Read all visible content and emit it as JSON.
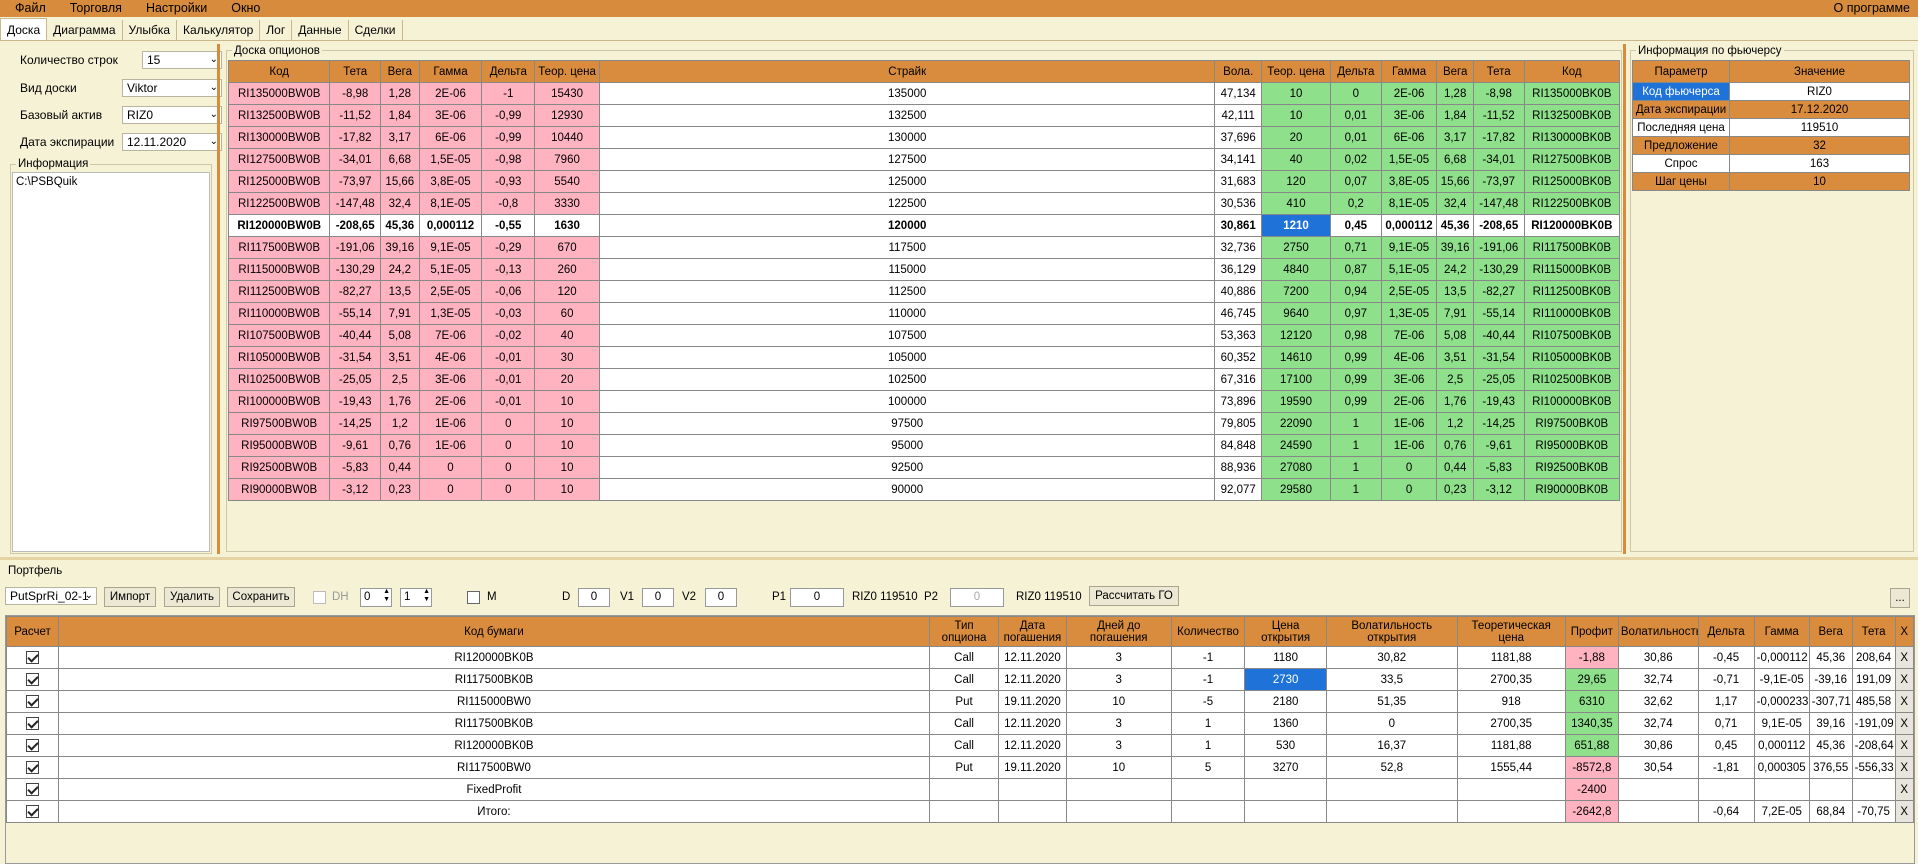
{
  "menu": {
    "items": [
      "Файл",
      "Торговля",
      "Настройки",
      "Окно"
    ],
    "about": "О программе"
  },
  "tabs": [
    "Доска",
    "Диаграмма",
    "Улыбка",
    "Калькулятор",
    "Лог",
    "Данные",
    "Сделки"
  ],
  "left": {
    "rows_label": "Количество строк",
    "rows_value": "15",
    "board_label": "Вид доски",
    "board_value": "Viktor",
    "asset_label": "Базовый актив",
    "asset_value": "RIZ0",
    "exp_label": "Дата экспирации",
    "exp_value": "12.11.2020",
    "info_title": "Информация",
    "info_text": "C:\\PSBQuik"
  },
  "board": {
    "title": "Доска опционов",
    "headers": [
      "Код",
      "Тета",
      "Вега",
      "Гамма",
      "Дельта",
      "Теор. цена",
      "Страйк",
      "Вола.",
      "Теор. цена",
      "Дельта",
      "Гамма",
      "Вега",
      "Тета",
      "Код"
    ],
    "rows": [
      [
        "RI135000BW0B",
        "-8,98",
        "1,28",
        "2E-06",
        "-1",
        "15430",
        "135000",
        "47,134",
        "10",
        "0",
        "2E-06",
        "1,28",
        "-8,98",
        "RI135000BK0B"
      ],
      [
        "RI132500BW0B",
        "-11,52",
        "1,84",
        "3E-06",
        "-0,99",
        "12930",
        "132500",
        "42,111",
        "10",
        "0,01",
        "3E-06",
        "1,84",
        "-11,52",
        "RI132500BK0B"
      ],
      [
        "RI130000BW0B",
        "-17,82",
        "3,17",
        "6E-06",
        "-0,99",
        "10440",
        "130000",
        "37,696",
        "20",
        "0,01",
        "6E-06",
        "3,17",
        "-17,82",
        "RI130000BK0B"
      ],
      [
        "RI127500BW0B",
        "-34,01",
        "6,68",
        "1,5E-05",
        "-0,98",
        "7960",
        "127500",
        "34,141",
        "40",
        "0,02",
        "1,5E-05",
        "6,68",
        "-34,01",
        "RI127500BK0B"
      ],
      [
        "RI125000BW0B",
        "-73,97",
        "15,66",
        "3,8E-05",
        "-0,93",
        "5540",
        "125000",
        "31,683",
        "120",
        "0,07",
        "3,8E-05",
        "15,66",
        "-73,97",
        "RI125000BK0B"
      ],
      [
        "RI122500BW0B",
        "-147,48",
        "32,4",
        "8,1E-05",
        "-0,8",
        "3330",
        "122500",
        "30,536",
        "410",
        "0,2",
        "8,1E-05",
        "32,4",
        "-147,48",
        "RI122500BK0B"
      ],
      [
        "RI120000BW0B",
        "-208,65",
        "45,36",
        "0,000112",
        "-0,55",
        "1630",
        "120000",
        "30,861",
        "1210",
        "0,45",
        "0,000112",
        "45,36",
        "-208,65",
        "RI120000BK0B"
      ],
      [
        "RI117500BW0B",
        "-191,06",
        "39,16",
        "9,1E-05",
        "-0,29",
        "670",
        "117500",
        "32,736",
        "2750",
        "0,71",
        "9,1E-05",
        "39,16",
        "-191,06",
        "RI117500BK0B"
      ],
      [
        "RI115000BW0B",
        "-130,29",
        "24,2",
        "5,1E-05",
        "-0,13",
        "260",
        "115000",
        "36,129",
        "4840",
        "0,87",
        "5,1E-05",
        "24,2",
        "-130,29",
        "RI115000BK0B"
      ],
      [
        "RI112500BW0B",
        "-82,27",
        "13,5",
        "2,5E-05",
        "-0,06",
        "120",
        "112500",
        "40,886",
        "7200",
        "0,94",
        "2,5E-05",
        "13,5",
        "-82,27",
        "RI112500BK0B"
      ],
      [
        "RI110000BW0B",
        "-55,14",
        "7,91",
        "1,3E-05",
        "-0,03",
        "60",
        "110000",
        "46,745",
        "9640",
        "0,97",
        "1,3E-05",
        "7,91",
        "-55,14",
        "RI110000BK0B"
      ],
      [
        "RI107500BW0B",
        "-40,44",
        "5,08",
        "7E-06",
        "-0,02",
        "40",
        "107500",
        "53,363",
        "12120",
        "0,98",
        "7E-06",
        "5,08",
        "-40,44",
        "RI107500BK0B"
      ],
      [
        "RI105000BW0B",
        "-31,54",
        "3,51",
        "4E-06",
        "-0,01",
        "30",
        "105000",
        "60,352",
        "14610",
        "0,99",
        "4E-06",
        "3,51",
        "-31,54",
        "RI105000BK0B"
      ],
      [
        "RI102500BW0B",
        "-25,05",
        "2,5",
        "3E-06",
        "-0,01",
        "20",
        "102500",
        "67,316",
        "17100",
        "0,99",
        "3E-06",
        "2,5",
        "-25,05",
        "RI102500BK0B"
      ],
      [
        "RI100000BW0B",
        "-19,43",
        "1,76",
        "2E-06",
        "-0,01",
        "10",
        "100000",
        "73,896",
        "19590",
        "0,99",
        "2E-06",
        "1,76",
        "-19,43",
        "RI100000BK0B"
      ],
      [
        "RI97500BW0B",
        "-14,25",
        "1,2",
        "1E-06",
        "0",
        "10",
        "97500",
        "79,805",
        "22090",
        "1",
        "1E-06",
        "1,2",
        "-14,25",
        "RI97500BK0B"
      ],
      [
        "RI95000BW0B",
        "-9,61",
        "0,76",
        "1E-06",
        "0",
        "10",
        "95000",
        "84,848",
        "24590",
        "1",
        "1E-06",
        "0,76",
        "-9,61",
        "RI95000BK0B"
      ],
      [
        "RI92500BW0B",
        "-5,83",
        "0,44",
        "0",
        "0",
        "10",
        "92500",
        "88,936",
        "27080",
        "1",
        "0",
        "0,44",
        "-5,83",
        "RI92500BK0B"
      ],
      [
        "RI90000BW0B",
        "-3,12",
        "0,23",
        "0",
        "0",
        "10",
        "90000",
        "92,077",
        "29580",
        "1",
        "0",
        "0,23",
        "-3,12",
        "RI90000BK0B"
      ]
    ],
    "bold_row": 6
  },
  "futures": {
    "title": "Информация по фьючерсу",
    "headers": [
      "Параметр",
      "Значение"
    ],
    "rows": [
      [
        "Код фьючерса",
        "RIZ0"
      ],
      [
        "Дата экспирации",
        "17.12.2020"
      ],
      [
        "Последняя цена",
        "119510"
      ],
      [
        "Предложение",
        "32"
      ],
      [
        "Спрос",
        "163"
      ],
      [
        "Шаг цены",
        "10"
      ]
    ]
  },
  "portfolio": {
    "title": "Портфель",
    "combo": "PutSprRi_02-1",
    "import": "Импорт",
    "delete": "Удалить",
    "save": "Сохранить",
    "dh": "DH",
    "spin1": "0",
    "spin2": "1",
    "m": "M",
    "d_label": "D",
    "d_val": "0",
    "v1_label": "V1",
    "v1_val": "0",
    "v2_label": "V2",
    "v2_val": "0",
    "p1_label": "P1",
    "p1_val": "0",
    "riz1": "RIZ0 119510",
    "p2_label": "P2",
    "p2_val": "0",
    "riz2": "RIZ0 119510",
    "calc": "Рассчитать ГО",
    "dots": "...",
    "headers": [
      "Расчет",
      "Код бумаги",
      "Тип опциона",
      "Дата погашения",
      "Дней до погашения",
      "Количество",
      "Цена открытия",
      "Волатильность открытия",
      "Теоретическая цена",
      "Профит",
      "Волатильность",
      "Дельта",
      "Гамма",
      "Вега",
      "Тета",
      "X"
    ],
    "rows": [
      [
        "RI120000BK0B",
        "Call",
        "12.11.2020",
        "3",
        "-1",
        "1180",
        "30,82",
        "1181,88",
        "-1,88",
        "30,86",
        "-0,45",
        "-0,000112",
        "45,36",
        "208,64",
        "X"
      ],
      [
        "RI117500BK0B",
        "Call",
        "12.11.2020",
        "3",
        "-1",
        "2730",
        "33,5",
        "2700,35",
        "29,65",
        "32,74",
        "-0,71",
        "-9,1E-05",
        "-39,16",
        "191,09",
        "X"
      ],
      [
        "RI115000BW0",
        "Put",
        "19.11.2020",
        "10",
        "-5",
        "2180",
        "51,35",
        "918",
        "6310",
        "32,62",
        "1,17",
        "-0,000233",
        "-307,71",
        "485,58",
        "X"
      ],
      [
        "RI117500BK0B",
        "Call",
        "12.11.2020",
        "3",
        "1",
        "1360",
        "0",
        "2700,35",
        "1340,35",
        "32,74",
        "0,71",
        "9,1E-05",
        "39,16",
        "-191,09",
        "X"
      ],
      [
        "RI120000BK0B",
        "Call",
        "12.11.2020",
        "3",
        "1",
        "530",
        "16,37",
        "1181,88",
        "651,88",
        "30,86",
        "0,45",
        "0,000112",
        "45,36",
        "-208,64",
        "X"
      ],
      [
        "RI117500BW0",
        "Put",
        "19.11.2020",
        "10",
        "5",
        "3270",
        "52,8",
        "1555,44",
        "-8572,8",
        "30,54",
        "-1,81",
        "0,000305",
        "376,55",
        "-556,33",
        "X"
      ],
      [
        "FixedProfit",
        "",
        "",
        "",
        "",
        "",
        "",
        "",
        "-2400",
        "",
        "",
        "",
        "",
        "",
        "X"
      ],
      [
        "Итого:",
        "",
        "",
        "",
        "",
        "",
        "",
        "",
        "-2642,8",
        "",
        "-0,64",
        "7,2E-05",
        "68,84",
        "-70,75",
        "X"
      ]
    ],
    "profit_colors": [
      "pink",
      "green",
      "green",
      "green",
      "green",
      "pink",
      "pink",
      "pink"
    ]
  }
}
